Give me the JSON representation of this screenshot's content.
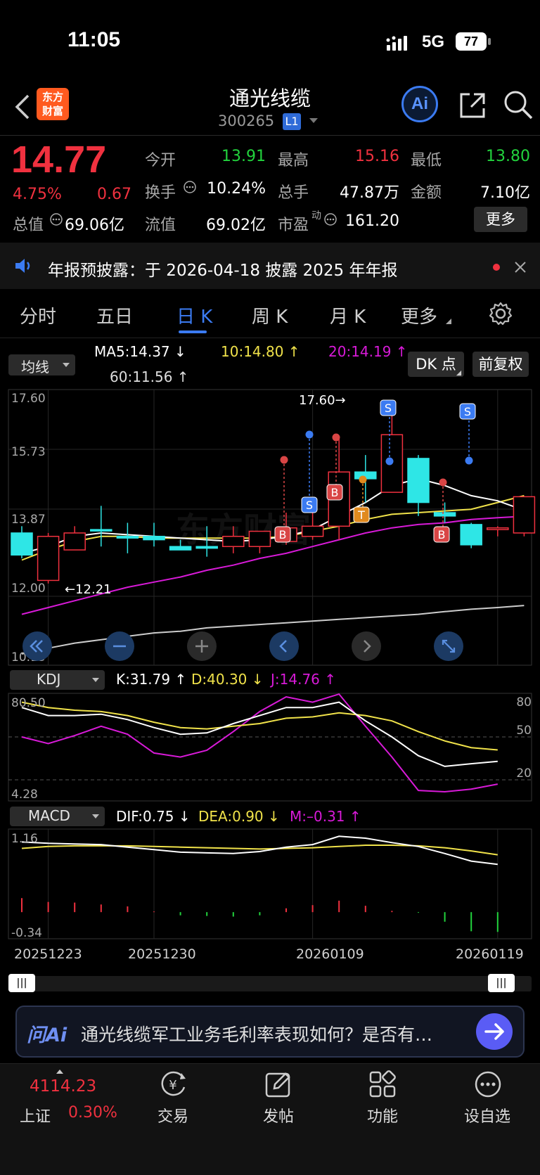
{
  "status_bar": {
    "time": "11:05",
    "network": "5G",
    "battery": "77"
  },
  "header": {
    "logo_line1": "东方",
    "logo_line2": "财富",
    "stock_name": "通光线缆",
    "stock_code": "300265",
    "level_badge": "L1",
    "ai_label": "Ai"
  },
  "quote": {
    "price": "14.77",
    "change_pct": "4.75%",
    "change": "0.67",
    "open_label": "今开",
    "open": "13.91",
    "high_label": "最高",
    "high": "15.16",
    "low_label": "最低",
    "low": "13.80",
    "turnover_label": "换手",
    "turnover": "10.24%",
    "volume_label": "总手",
    "volume": "47.87万",
    "amount_label": "金额",
    "amount": "7.10亿",
    "mktcap_label": "总值",
    "mktcap": "69.06亿",
    "float_label": "流值",
    "float_cap": "69.02亿",
    "pe_label": "市盈",
    "pe_sup": "动",
    "pe": "161.20",
    "more_label": "更多"
  },
  "notice": {
    "text": "年报预披露：于 2026-04-18 披露 2025 年年报"
  },
  "tabs": [
    {
      "label": "分时",
      "active": false
    },
    {
      "label": "五日",
      "active": false
    },
    {
      "label": "日 K",
      "active": true
    },
    {
      "label": "周 K",
      "active": false
    },
    {
      "label": "月 K",
      "active": false
    },
    {
      "label": "更多",
      "active": false
    }
  ],
  "indicator_bar": {
    "ma_select": "均线",
    "ma5": "MA5:14.37 ↓",
    "ma10": "10:14.80 ↑",
    "ma20": "20:14.19 ↑",
    "ma60": "60:11.56 ↑",
    "dk_button": "DK 点",
    "adjust_button": "前复权"
  },
  "kline_axis": {
    "y_top": "17.60",
    "y_2": "15.73",
    "y_3": "13.87",
    "y_4": "12.00",
    "y_bottom": "10.13",
    "max_label": "17.60→",
    "min_label": "←12.21"
  },
  "signals": [
    {
      "label": "S",
      "kind": "sell"
    },
    {
      "label": "B",
      "kind": "buy"
    },
    {
      "label": "B",
      "kind": "buy"
    },
    {
      "label": "T",
      "kind": "t"
    },
    {
      "label": "S",
      "kind": "sell"
    },
    {
      "label": "B",
      "kind": "buy"
    },
    {
      "label": "S",
      "kind": "sell"
    }
  ],
  "kdj": {
    "select": "KDJ",
    "k": "K:31.79 ↑",
    "d": "D:40.30 ↓",
    "j": "J:14.76 ↑",
    "y_top": "80.50",
    "y_bottom": "4.28",
    "r_80": "80",
    "r_50": "50",
    "r_20": "20"
  },
  "macd": {
    "select": "MACD",
    "dif": "DIF:0.75 ↓",
    "dea": "DEA:0.90 ↓",
    "m": "M:–0.31 ↑",
    "y_top": "1.16",
    "y_bottom": "-0.34"
  },
  "dates": [
    "20251223",
    "20251230",
    "20260109",
    "20260119"
  ],
  "ask_ai": {
    "logo": "问Ai",
    "placeholder": "通光线缆军工业务毛利率表现如何？是否有…"
  },
  "bottom_nav": {
    "index_value": "4114.23",
    "index_name": "上证",
    "index_change": "0.30%",
    "items": [
      {
        "label": "交易"
      },
      {
        "label": "发帖"
      },
      {
        "label": "功能"
      },
      {
        "label": "设自选"
      }
    ]
  },
  "colors": {
    "up": "#f0313f",
    "down": "#22d33d",
    "candle_down": "#2ee6e6",
    "ma5": "#ffffff",
    "ma10": "#f0e24a",
    "ma20": "#d81ad8",
    "ma60": "#cccccc",
    "accent": "#2f6bd8"
  },
  "chart_data": {
    "type": "candlestick",
    "ylim": [
      10.13,
      17.6
    ],
    "candles": [
      {
        "open": 13.7,
        "high": 13.9,
        "low": 12.95,
        "close": 13.05
      },
      {
        "open": 12.3,
        "high": 13.7,
        "low": 12.21,
        "close": 13.6
      },
      {
        "open": 13.2,
        "high": 13.9,
        "low": 13.2,
        "close": 13.7
      },
      {
        "open": 13.8,
        "high": 14.5,
        "low": 13.3,
        "close": 13.78
      },
      {
        "open": 13.6,
        "high": 14.0,
        "low": 13.1,
        "close": 13.55
      },
      {
        "open": 13.6,
        "high": 14.0,
        "low": 13.3,
        "close": 13.5
      },
      {
        "open": 13.3,
        "high": 13.5,
        "low": 13.2,
        "close": 13.2
      },
      {
        "open": 13.3,
        "high": 13.9,
        "low": 13.0,
        "close": 13.25
      },
      {
        "open": 13.3,
        "high": 13.9,
        "low": 13.1,
        "close": 13.6
      },
      {
        "open": 13.3,
        "high": 13.7,
        "low": 13.1,
        "close": 13.75
      },
      {
        "open": 13.45,
        "high": 14.3,
        "low": 13.35,
        "close": 13.85
      },
      {
        "open": 13.6,
        "high": 14.5,
        "low": 13.5,
        "close": 13.9
      },
      {
        "open": 13.9,
        "high": 16.5,
        "low": 13.5,
        "close": 15.5
      },
      {
        "open": 15.5,
        "high": 16.0,
        "low": 14.6,
        "close": 15.3
      },
      {
        "open": 14.9,
        "high": 17.6,
        "low": 14.9,
        "close": 16.6
      },
      {
        "open": 15.9,
        "high": 16.0,
        "low": 14.2,
        "close": 14.6
      },
      {
        "open": 14.3,
        "high": 14.6,
        "low": 14.0,
        "close": 14.2
      },
      {
        "open": 13.95,
        "high": 14.0,
        "low": 13.25,
        "close": 13.35
      },
      {
        "open": 13.8,
        "high": 13.9,
        "low": 13.6,
        "close": 13.85
      },
      {
        "open": 13.7,
        "high": 14.3,
        "low": 13.6,
        "close": 14.77
      }
    ],
    "ma5": [
      13.1,
      13.3,
      13.6,
      13.7,
      13.65,
      13.6,
      13.55,
      13.5,
      13.45,
      13.5,
      13.6,
      13.8,
      14.2,
      14.6,
      15.1,
      15.3,
      15.1,
      14.8,
      14.65,
      14.37
    ],
    "ma10": [
      12.9,
      13.2,
      13.45,
      13.6,
      13.6,
      13.55,
      13.55,
      13.55,
      13.55,
      13.55,
      13.6,
      13.75,
      13.9,
      14.1,
      14.25,
      14.3,
      14.35,
      14.4,
      14.6,
      14.8
    ],
    "ma20": [
      11.3,
      11.5,
      11.7,
      11.9,
      12.1,
      12.25,
      12.4,
      12.6,
      12.75,
      12.95,
      13.1,
      13.3,
      13.5,
      13.7,
      13.85,
      13.95,
      14.0,
      14.1,
      14.15,
      14.19
    ],
    "ma60": [
      10.13,
      10.3,
      10.45,
      10.55,
      10.65,
      10.75,
      10.8,
      10.9,
      10.95,
      11.0,
      11.05,
      11.1,
      11.15,
      11.2,
      11.25,
      11.3,
      11.38,
      11.45,
      11.5,
      11.56
    ],
    "kdj": {
      "ylim": [
        4.28,
        80.5
      ],
      "k": [
        72,
        66,
        66,
        67,
        63,
        57,
        52,
        53,
        60,
        66,
        72,
        72,
        76,
        62,
        50,
        36,
        28,
        30,
        31.79
      ],
      "d": [
        76,
        72,
        70,
        69,
        66,
        61,
        57,
        56,
        58,
        60,
        64,
        65,
        68,
        66,
        62,
        54,
        47,
        42,
        40.3
      ],
      "j": [
        50,
        45,
        51,
        58,
        52,
        38,
        35,
        40,
        54,
        69,
        80,
        76,
        82,
        58,
        35,
        10,
        9,
        11,
        14.76
      ]
    },
    "macd": {
      "ylim": [
        -0.34,
        1.16
      ],
      "dif": [
        1.1,
        1.08,
        1.07,
        1.06,
        1.02,
        0.98,
        0.94,
        0.93,
        0.92,
        0.95,
        1.02,
        1.06,
        1.19,
        1.16,
        1.09,
        1.03,
        0.92,
        0.8,
        0.75
      ],
      "dea": [
        1.0,
        1.03,
        1.04,
        1.04,
        1.04,
        1.03,
        1.02,
        1.01,
        1.0,
        0.99,
        1.0,
        1.01,
        1.03,
        1.05,
        1.05,
        1.04,
        1.01,
        0.96,
        0.9
      ],
      "m": [
        0.22,
        0.16,
        0.15,
        0.12,
        0.09,
        0.01,
        -0.05,
        -0.06,
        -0.07,
        -0.05,
        0.06,
        0.11,
        0.18,
        0.1,
        0.02,
        -0.01,
        -0.15,
        -0.3,
        -0.31
      ]
    }
  }
}
